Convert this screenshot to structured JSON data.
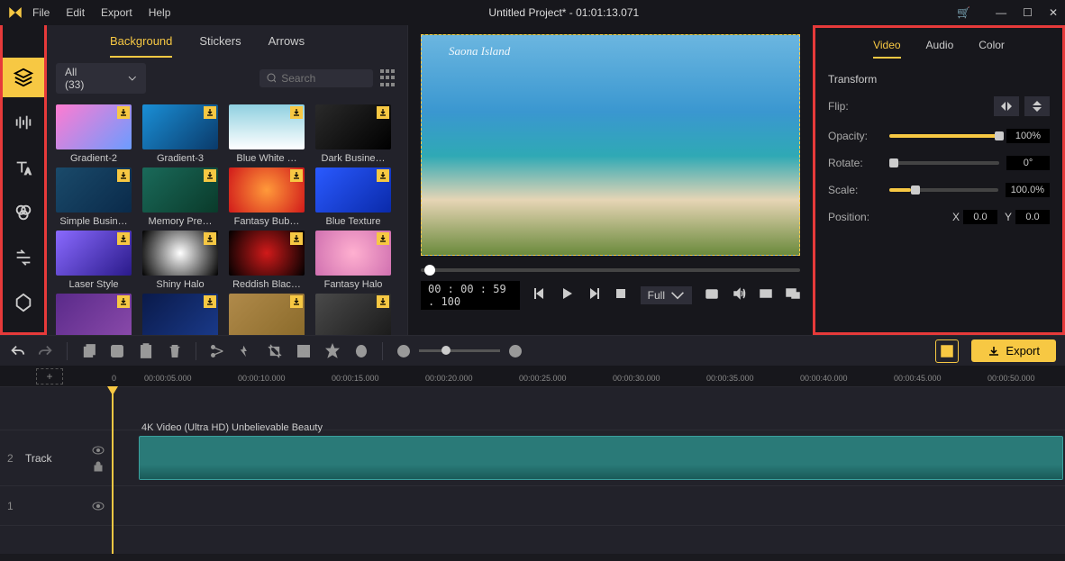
{
  "titlebar": {
    "menu": [
      "File",
      "Edit",
      "Export",
      "Help"
    ],
    "title": "Untitled Project* - 01:01:13.071"
  },
  "media": {
    "tabs": [
      "Background",
      "Stickers",
      "Arrows"
    ],
    "activeTab": 0,
    "filter": "All (33)",
    "search_placeholder": "Search",
    "thumbs": [
      [
        {
          "label": "Gradient-2",
          "bg": "linear-gradient(135deg,#ff7bd1,#6b9cff)"
        },
        {
          "label": "Gradient-3",
          "bg": "linear-gradient(135deg,#1a8fd6,#0a3a6a)"
        },
        {
          "label": "Blue White …",
          "bg": "linear-gradient(180deg,#8fd0e0,#ffffff)"
        },
        {
          "label": "Dark Busine…",
          "bg": "linear-gradient(135deg,#2a2a2a,#000)"
        }
      ],
      [
        {
          "label": "Simple Busin…",
          "bg": "linear-gradient(135deg,#1a4a6a,#0a2a4a)"
        },
        {
          "label": "Memory Pre…",
          "bg": "linear-gradient(135deg,#1a6a5a,#0a3a2a)"
        },
        {
          "label": "Fantasy Bub…",
          "bg": "radial-gradient(circle,#ff9a3a,#d11a1a)"
        },
        {
          "label": "Blue Texture",
          "bg": "linear-gradient(135deg,#2a5aff,#0a2aaa)"
        }
      ],
      [
        {
          "label": "Laser Style",
          "bg": "linear-gradient(135deg,#8a6aff,#2a1a8a)"
        },
        {
          "label": "Shiny Halo",
          "bg": "radial-gradient(circle,#fff,#000)"
        },
        {
          "label": "Reddish Blac…",
          "bg": "radial-gradient(circle,#d11a1a,#000)"
        },
        {
          "label": "Fantasy Halo",
          "bg": "radial-gradient(circle,#ffb0d0,#d070b0)"
        }
      ],
      [
        {
          "label": "",
          "bg": "linear-gradient(135deg,#5a2a8a,#8a4aaa)"
        },
        {
          "label": "",
          "bg": "linear-gradient(135deg,#0a1a4a,#1a3a8a)"
        },
        {
          "label": "",
          "bg": "linear-gradient(135deg,#b08a4a,#8a6a2a)"
        },
        {
          "label": "",
          "bg": "linear-gradient(135deg,#4a4a4a,#1a1a1a)"
        }
      ]
    ]
  },
  "preview": {
    "watermark": "Saona Island",
    "timecode": "00 : 00 : 59 . 100",
    "fit": "Full"
  },
  "props": {
    "tabs": [
      "Video",
      "Audio",
      "Color"
    ],
    "activeTab": 0,
    "section": "Transform",
    "flip": "Flip:",
    "opacity_lbl": "Opacity:",
    "opacity_val": "100%",
    "rotate_lbl": "Rotate:",
    "rotate_val": "0°",
    "scale_lbl": "Scale:",
    "scale_val": "100.0%",
    "position_lbl": "Position:",
    "pos_x_lbl": "X",
    "pos_x": "0.0",
    "pos_y_lbl": "Y",
    "pos_y": "0.0"
  },
  "export_label": "Export",
  "ruler": {
    "zero": "0",
    "ticks": [
      "00:00:05.000",
      "00:00:10.000",
      "00:00:15.000",
      "00:00:20.000",
      "00:00:25.000",
      "00:00:30.000",
      "00:00:35.000",
      "00:00:40.000",
      "00:00:45.000",
      "00:00:50.000"
    ]
  },
  "tracks": {
    "t2": {
      "num": "2",
      "label": "Track"
    },
    "clip_title": "4K Video (Ultra HD) Unbelievable Beauty",
    "t1": {
      "num": "1"
    }
  }
}
